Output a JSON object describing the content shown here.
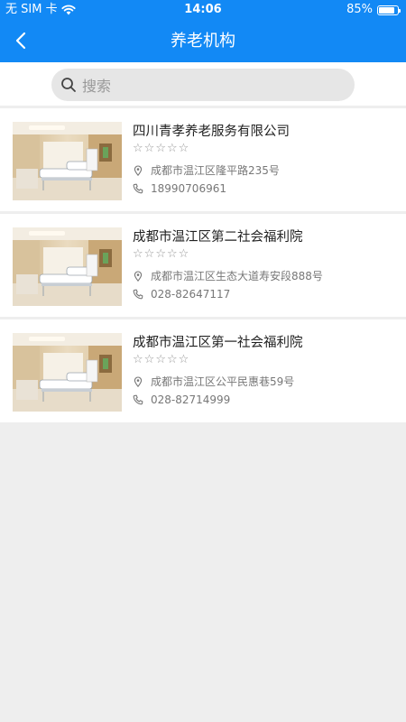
{
  "status_bar": {
    "carrier": "无 SIM 卡",
    "time": "14:06",
    "battery_text": "85%",
    "battery_level": 0.85
  },
  "nav": {
    "title": "养老机构",
    "back_icon": "chevron-left-icon"
  },
  "search": {
    "placeholder": "搜索",
    "value": ""
  },
  "colors": {
    "primary": "#1289f5",
    "background": "#eeeeee"
  },
  "institutions": [
    {
      "name": "四川青孝养老服务有限公司",
      "rating": 0,
      "address": "成都市温江区隆平路235号",
      "phone": "18990706961"
    },
    {
      "name": "成都市温江区第二社会福利院",
      "rating": 0,
      "address": "成都市温江区生态大道寿安段888号",
      "phone": "028-82647117"
    },
    {
      "name": "成都市温江区第一社会福利院",
      "rating": 0,
      "address": "成都市温江区公平民惠巷59号",
      "phone": "028-82714999"
    }
  ]
}
